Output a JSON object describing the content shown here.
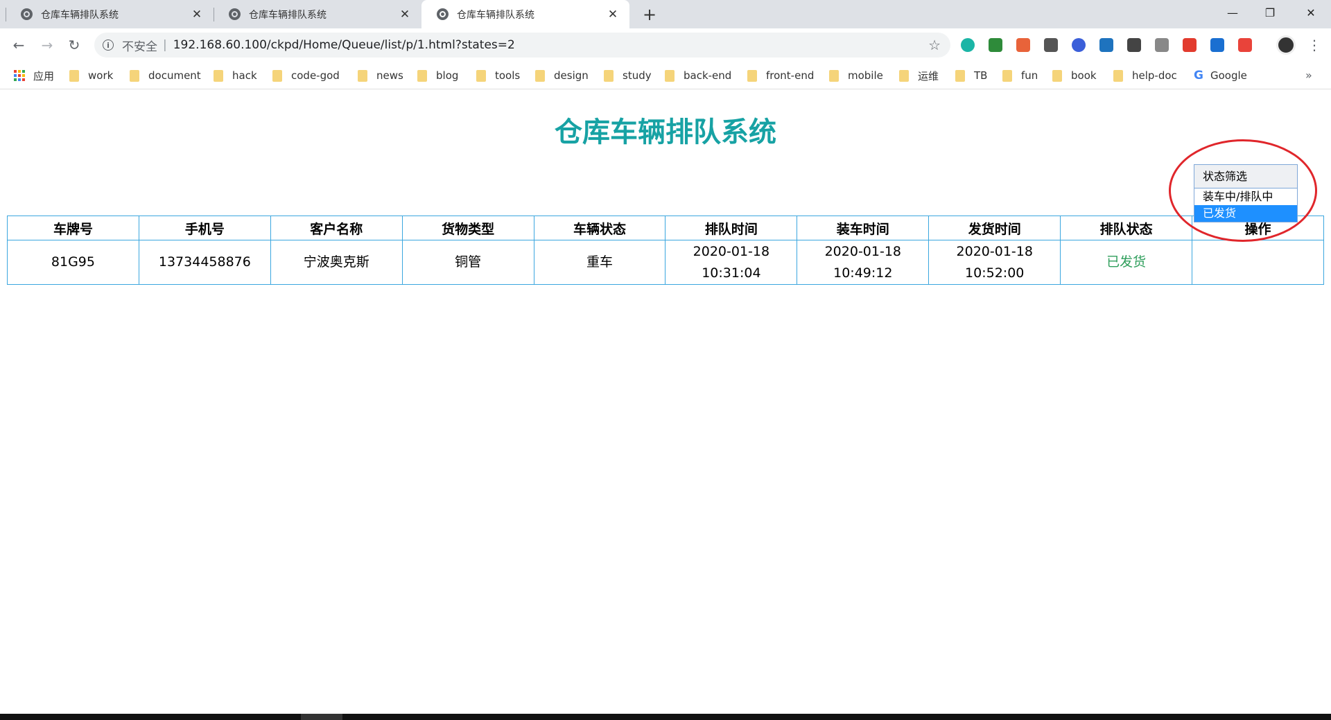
{
  "browser": {
    "tabs": [
      {
        "title": "仓库车辆排队系统",
        "active": false
      },
      {
        "title": "仓库车辆排队系统",
        "active": false
      },
      {
        "title": "仓库车辆排队系统",
        "active": true
      }
    ],
    "new_tab": "+",
    "window_controls": {
      "minimize": "—",
      "restore": "❐",
      "close": "✕"
    },
    "nav": {
      "back": "←",
      "forward": "→",
      "reload": "↻"
    },
    "omnibox": {
      "info_glyph": "i",
      "security_label": "不安全",
      "separator": "|",
      "url": "192.168.60.100/ckpd/Home/Queue/list/p/1.html?states=2"
    },
    "star_glyph": "☆",
    "menu_glyph": "⋮",
    "extensions": [
      {
        "name": "ext-teal",
        "color": "#1bb5a6"
      },
      {
        "name": "ext-green",
        "color": "#2e8b3a"
      },
      {
        "name": "ext-orange",
        "color": "#e8633a"
      },
      {
        "name": "ext-gear",
        "color": "#555555"
      },
      {
        "name": "ext-blue-circle",
        "color": "#3b5fd9"
      },
      {
        "name": "ext-s",
        "color": "#1e73be"
      },
      {
        "name": "ext-qr",
        "color": "#444444"
      },
      {
        "name": "ext-v",
        "color": "#888888"
      },
      {
        "name": "ext-red",
        "color": "#e23b2e"
      },
      {
        "name": "ext-blue2",
        "color": "#1a6fd1"
      },
      {
        "name": "ext-red2",
        "color": "#e9433a"
      }
    ],
    "bookmarks": {
      "apps_label": "应用",
      "items": [
        "work",
        "document",
        "hack",
        "code-god",
        "news",
        "blog",
        "tools",
        "design",
        "study",
        "back-end",
        "front-end",
        "mobile",
        "运维",
        "TB",
        "fun",
        "book",
        "help-doc"
      ],
      "google_glyph": "G",
      "google_label": "Google",
      "more": "»"
    }
  },
  "page": {
    "title": "仓库车辆排队系统",
    "filter": {
      "label": "状态筛选",
      "options": [
        "装车中/排队中",
        "已发货"
      ],
      "selected_index": 1
    },
    "table": {
      "headers": [
        "车牌号",
        "手机号",
        "客户名称",
        "货物类型",
        "车辆状态",
        "排队时间",
        "装车时间",
        "发货时间",
        "排队状态",
        "操作"
      ],
      "rows": [
        {
          "plate": "81G95",
          "phone": "13734458876",
          "customer": "宁波奥克斯",
          "cargo_type": "铜管",
          "vehicle_state": "重车",
          "queue_date": "2020-01-18",
          "queue_time": "10:31:04",
          "load_date": "2020-01-18",
          "load_time": "10:49:12",
          "ship_date": "2020-01-18",
          "ship_time": "10:52:00",
          "queue_status": "已发货",
          "action": ""
        }
      ]
    }
  },
  "colors": {
    "title": "#17a2a4",
    "table_border": "#3aa6df",
    "status_shipped": "#2e9e5b",
    "selected_option": "#1e90ff",
    "annotation_circle": "#e0262b"
  }
}
